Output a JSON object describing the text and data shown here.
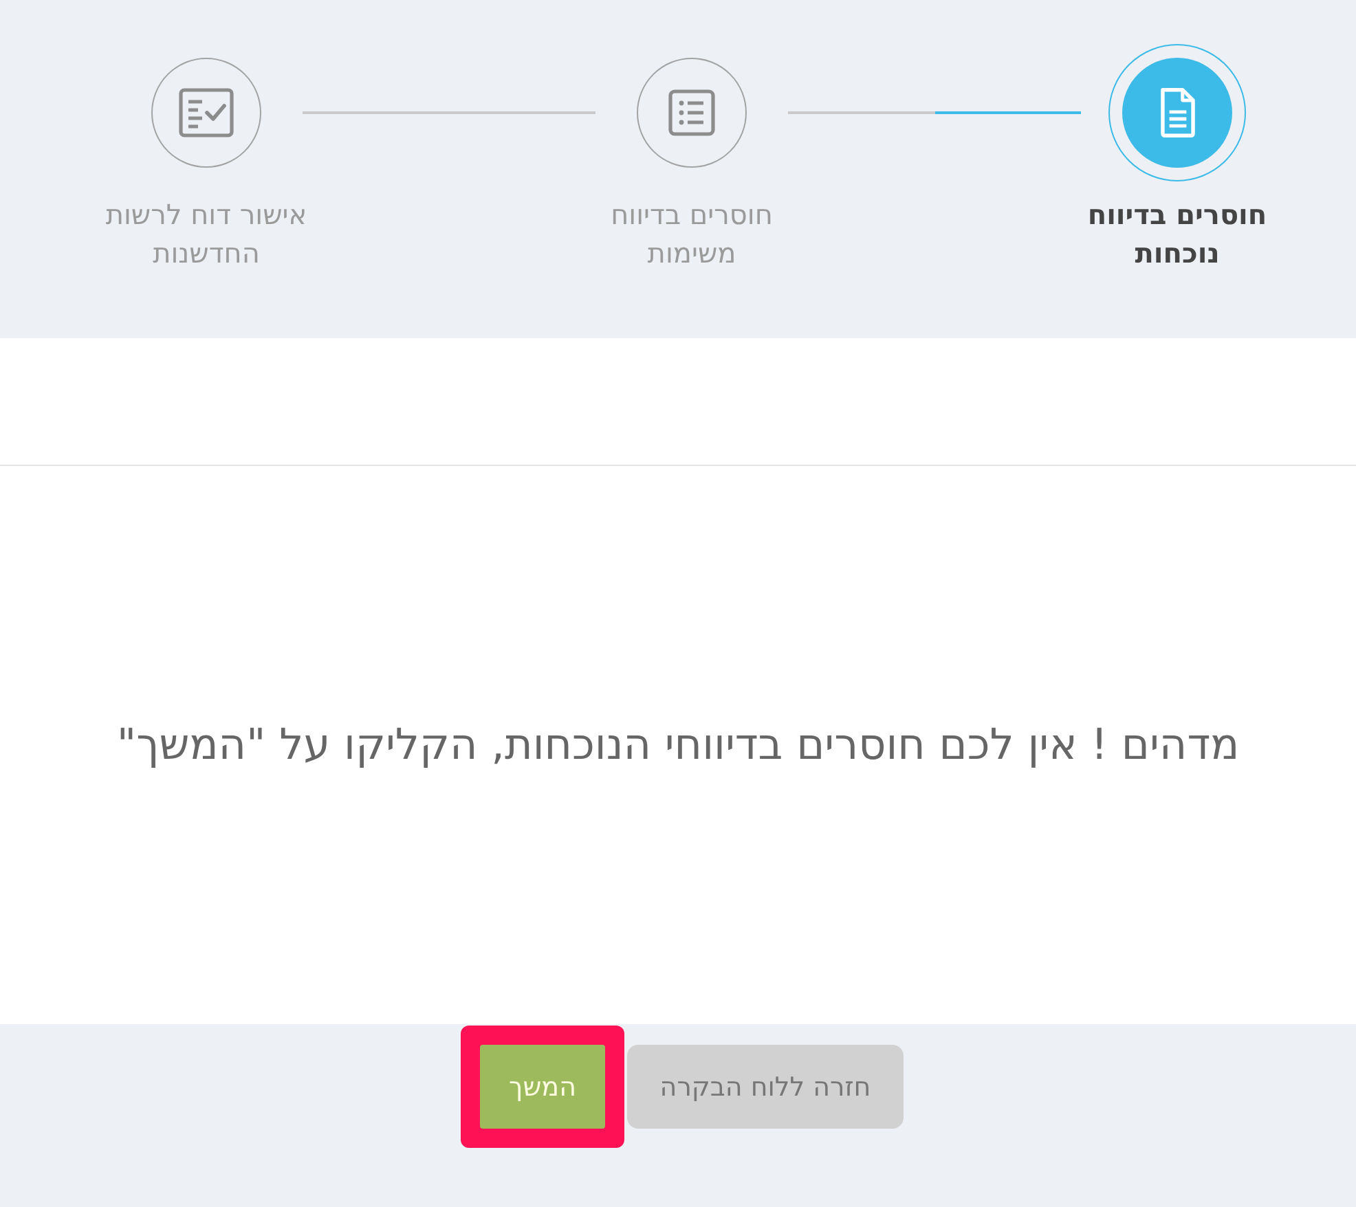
{
  "steps": [
    {
      "label": "חוסרים בדיווח נוכחות",
      "selected": true,
      "level": 0.5
    },
    {
      "label": "חוסרים בדיווח משימות",
      "selected": false
    },
    {
      "label": "אישור דוח לרשות החדשנות",
      "selected": false
    }
  ],
  "message": "מדהים ! אין לכם חוסרים בדיווחי הנוכחות, הקליקו על \"המשך\"",
  "buttons": [
    {
      "label": "חזרה ללוח הבקרה",
      "kind": "secondary",
      "highlighted": false
    },
    {
      "label": "המשך",
      "kind": "primary",
      "highlighted": true
    }
  ]
}
